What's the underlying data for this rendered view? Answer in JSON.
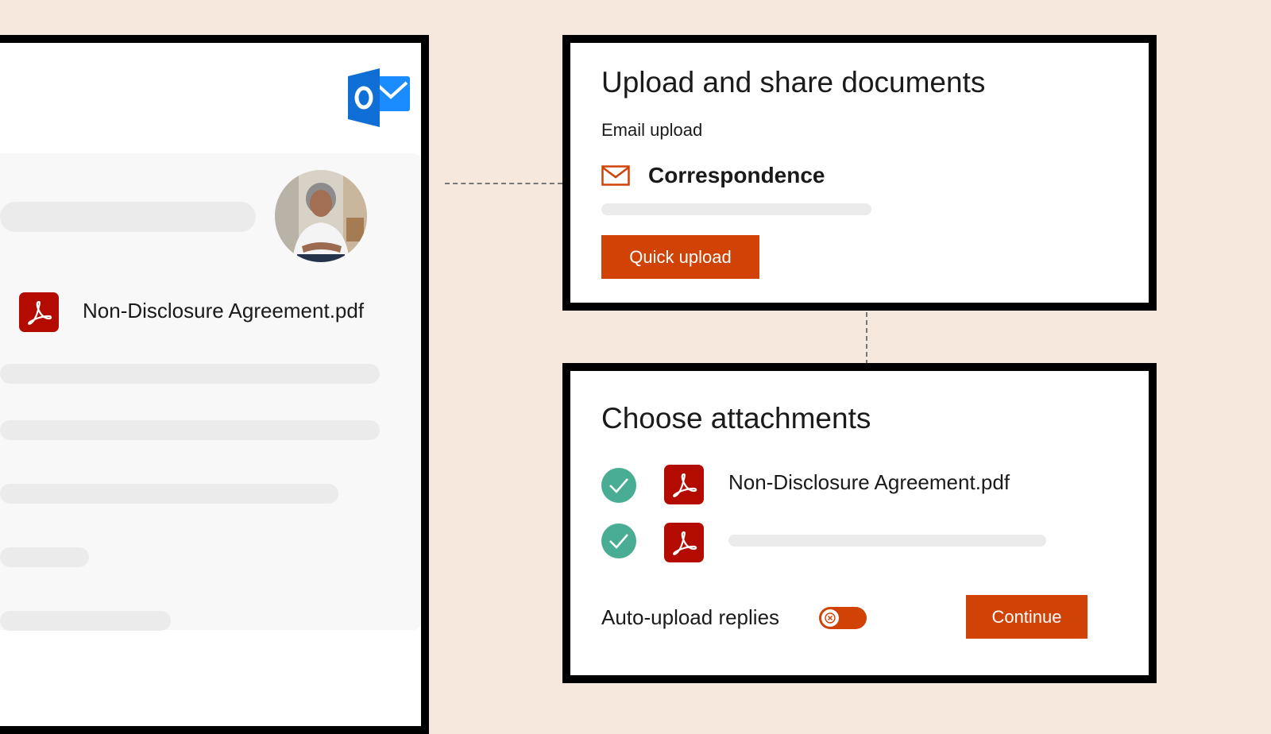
{
  "email_panel": {
    "attachment_filename": "Non-Disclosure Agreement.pdf"
  },
  "upload_card": {
    "title": "Upload and share documents",
    "subtitle": "Email upload",
    "folder_label": "Correspondence",
    "quick_upload_label": "Quick upload"
  },
  "attach_card": {
    "title": "Choose attachments",
    "attachments": [
      {
        "filename": "Non-Disclosure Agreement.pdf",
        "selected": true
      },
      {
        "filename": "",
        "selected": true
      }
    ],
    "auto_upload_label": "Auto-upload replies",
    "auto_upload_enabled": false,
    "continue_label": "Continue"
  },
  "colors": {
    "background": "#f6e8dc",
    "accent": "#d04205",
    "pdf_red": "#b30b00",
    "check_green": "#48ad92",
    "outlook_blue": "#1a8cff"
  },
  "icons": [
    "outlook-icon",
    "pdf-icon",
    "envelope-icon",
    "checkmark-icon",
    "close-icon"
  ]
}
